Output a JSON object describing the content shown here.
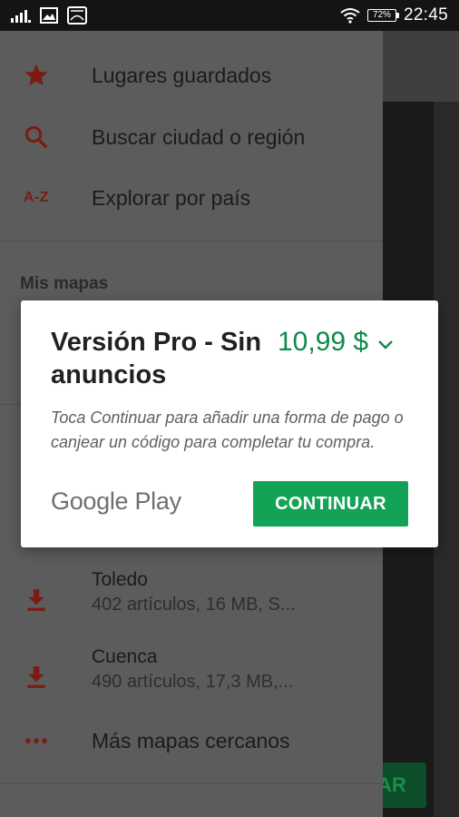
{
  "status_bar": {
    "battery": "72%",
    "time": "22:45"
  },
  "drawer": {
    "items": [
      {
        "label": "Lugares guardados",
        "icon": "star-icon"
      },
      {
        "label": "Buscar ciudad o región",
        "icon": "search-icon"
      },
      {
        "label": "Explorar por país",
        "icon_text": "A-Z"
      }
    ],
    "section_title": "Mis mapas",
    "maps": [
      {
        "name": "Toledo",
        "meta": "402 artículos, 16 MB, S..."
      },
      {
        "name": "Cuenca",
        "meta": "490 artículos, 17,3 MB,..."
      }
    ],
    "more_label": "Más mapas cercanos"
  },
  "background": {
    "cta_label": "AR"
  },
  "dialog": {
    "title": "Versión Pro - Sin anuncios",
    "price": "10,99 $",
    "description": "Toca Continuar para añadir una forma de pago o canjear un código para completar tu compra.",
    "brand": "Google Play",
    "continue_label": "CONTINUAR"
  },
  "colors": {
    "accent_red": "#7a1b14",
    "price_green": "#0f8a4a",
    "button_green": "#12a356"
  }
}
